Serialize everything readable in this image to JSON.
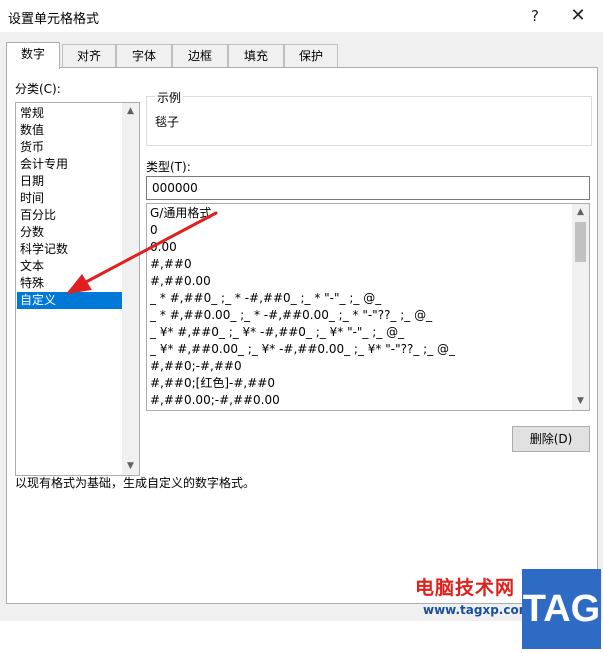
{
  "window": {
    "title": "设置单元格格式",
    "help_glyph": "?",
    "close_glyph": "✕"
  },
  "tabs": [
    {
      "label": "数字",
      "active": true
    },
    {
      "label": "对齐"
    },
    {
      "label": "字体"
    },
    {
      "label": "边框"
    },
    {
      "label": "填充"
    },
    {
      "label": "保护"
    }
  ],
  "category": {
    "label": "分类(C):",
    "items": [
      "常规",
      "数值",
      "货币",
      "会计专用",
      "日期",
      "时间",
      "百分比",
      "分数",
      "科学记数",
      "文本",
      "特殊",
      "自定义"
    ],
    "selected": "自定义"
  },
  "sample": {
    "legend": "示例",
    "value": "毯子"
  },
  "type": {
    "label": "类型(T):",
    "value": "000000",
    "formats": [
      "G/通用格式",
      "0",
      "0.00",
      "#,##0",
      "#,##0.00",
      "_ * #,##0_ ;_ * -#,##0_ ;_ * \"-\"_ ;_ @_",
      "_ * #,##0.00_ ;_ * -#,##0.00_ ;_ * \"-\"??_ ;_ @_",
      "_ ¥* #,##0_ ;_ ¥* -#,##0_ ;_ ¥* \"-\"_ ;_ @_",
      "_ ¥* #,##0.00_ ;_ ¥* -#,##0.00_ ;_ ¥* \"-\"??_ ;_ @_",
      "#,##0;-#,##0",
      "#,##0;[红色]-#,##0",
      "#,##0.00;-#,##0.00"
    ]
  },
  "delete_button": "删除(D)",
  "description": "以现有格式为基础，生成自定义的数字格式。",
  "watermark": {
    "text": "电脑技术网",
    "url": "www.tagxp.com",
    "badge": "TAG"
  },
  "colors": {
    "accent": "#0078d7",
    "annotation_arrow": "#e02020"
  },
  "icons": {
    "scroll_up": "▲",
    "scroll_down": "▼"
  }
}
